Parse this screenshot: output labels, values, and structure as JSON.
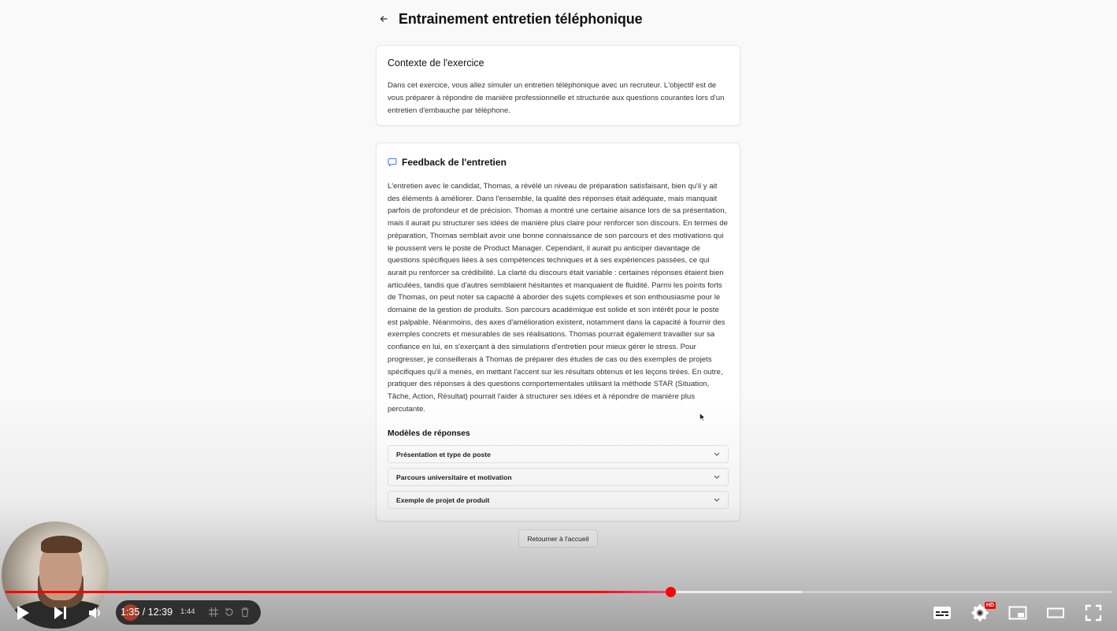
{
  "header": {
    "back_icon": "arrow-left-icon",
    "title": "Entrainement entretien téléphonique"
  },
  "context": {
    "title": "Contexte de l'exercice",
    "text": "Dans cet exercice, vous allez simuler un entretien téléphonique avec un recruteur. L'objectif est de vous préparer à répondre de manière professionnelle et structurée aux questions courantes lors d'un entretien d'embauche par téléphone."
  },
  "feedback": {
    "icon": "chat-icon",
    "title": "Feedback de l'entretien",
    "text": "L'entretien avec le candidat, Thomas, a révélé un niveau de préparation satisfaisant, bien qu'il y ait des éléments à améliorer. Dans l'ensemble, la qualité des réponses était adéquate, mais manquait parfois de profondeur et de précision. Thomas a montré une certaine aisance lors de sa présentation, mais il aurait pu structurer ses idées de manière plus claire pour renforcer son discours. En termes de préparation, Thomas semblait avoir une bonne connaissance de son parcours et des motivations qui le poussent vers le poste de Product Manager. Cependant, il aurait pu anticiper davantage de questions spécifiques liées à ses compétences techniques et à ses expériences passées, ce qui aurait pu renforcer sa crédibilité. La clarté du discours était variable : certaines réponses étaient bien articulées, tandis que d'autres semblaient hésitantes et manquaient de fluidité. Parmi les points forts de Thomas, on peut noter sa capacité à aborder des sujets complexes et son enthousiasme pour le domaine de la gestion de produits. Son parcours académique est solide et son intérêt pour le poste est palpable. Néanmoins, des axes d'amélioration existent, notamment dans la capacité à fournir des exemples concrets et mesurables de ses réalisations. Thomas pourrait également travailler sur sa confiance en lui, en s'exerçant à des simulations d'entretien pour mieux gérer le stress. Pour progresser, je conseillerais à Thomas de préparer des études de cas ou des exemples de projets spécifiques qu'il a menés, en mettant l'accent sur les résultats obtenus et les leçons tirées. En outre, pratiquer des réponses à des questions comportementales utilisant la méthode STAR (Situation, Tâche, Action, Résultat) pourrait l'aider à structurer ses idées et à répondre de manière plus percutante.",
    "models_title": "Modèles de réponses",
    "models": [
      {
        "label": "Présentation et type de poste",
        "icon": "chevron-down-icon"
      },
      {
        "label": "Parcours universitaire et motivation",
        "icon": "chevron-down-icon"
      },
      {
        "label": "Exemple de projet de produit",
        "icon": "chevron-down-icon"
      }
    ]
  },
  "home_button": {
    "label": "Retourner à l'accueil"
  },
  "player": {
    "time_display": "1:35 / 12:39",
    "recording_time": "1:44",
    "progress_played": 0.601,
    "progress_buffered": 0.72,
    "hd_badge": "HD",
    "accent_color": "#ff0000"
  }
}
